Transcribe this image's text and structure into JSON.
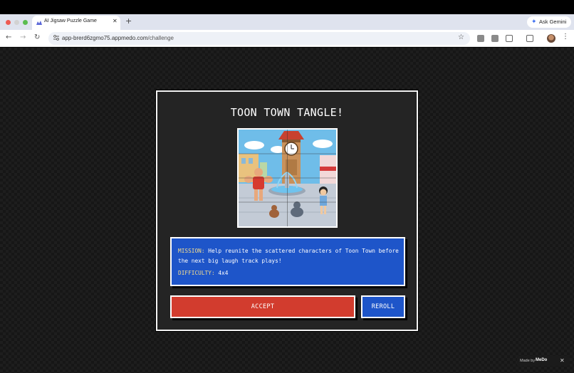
{
  "browser": {
    "tab_title": "AI Jigsaw Puzzle Game",
    "tab_close": "✕",
    "new_tab": "+",
    "gemini_label": "Ask Gemini",
    "url_host": "app-brerd6zgmo75.appmedo.com",
    "url_path": "/challenge",
    "back": "←",
    "forward": "→",
    "reload": "↻",
    "star": "☆",
    "menu": "⋮"
  },
  "challenge": {
    "title": "TOON TOWN TANGLE!",
    "mission_label": "MISSION:",
    "mission_text": "Help reunite the scattered characters of Toon Town before the next big laugh track plays!",
    "difficulty_label": "DIFFICULTY:",
    "difficulty_value": "4x4",
    "accept_label": "ACCEPT",
    "reroll_label": "REROLL"
  },
  "badge": {
    "made_by": "Made by",
    "brand": "MeDo",
    "close": "✕"
  },
  "colors": {
    "accept": "#d23c2e",
    "mission_bg": "#1e55c9",
    "label_accent": "#f5dd8e"
  }
}
